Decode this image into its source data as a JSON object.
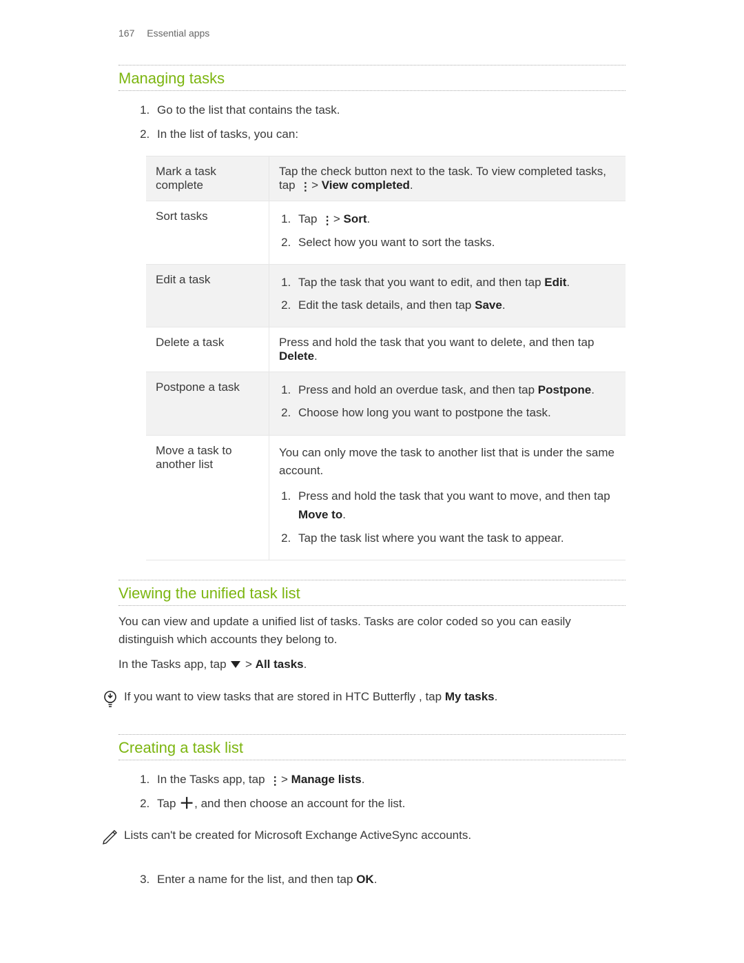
{
  "page": {
    "number": "167",
    "section": "Essential apps"
  },
  "sec1": {
    "title": "Managing tasks",
    "step1": "Go to the list that contains the task.",
    "step2": "In the list of tasks, you can:",
    "rows": {
      "mark": {
        "label": "Mark a task complete",
        "text_a": "Tap the check button next to the task. To view completed tasks, tap ",
        "text_b": " > ",
        "view_completed": "View completed",
        "period": "."
      },
      "sort": {
        "label": "Sort tasks",
        "s1a": "Tap ",
        "s1b": " > ",
        "sort_word": "Sort",
        "s1c": ".",
        "s2": "Select how you want to sort the tasks."
      },
      "edit": {
        "label": "Edit a task",
        "s1a": "Tap the task that you want to edit, and then tap ",
        "edit_word": "Edit",
        "s1b": ".",
        "s2a": "Edit the task details, and then tap ",
        "save_word": "Save",
        "s2b": "."
      },
      "delete": {
        "label": "Delete a task",
        "text_a": "Press and hold the task that you want to delete, and then tap ",
        "delete_word": "Delete",
        "text_b": "."
      },
      "postpone": {
        "label": "Postpone a task",
        "s1a": "Press and hold an overdue task, and then tap ",
        "postpone_word": "Postpone",
        "s1b": ".",
        "s2": "Choose how long you want to postpone the task."
      },
      "move": {
        "label": "Move a task to another list",
        "intro": "You can only move the task to another list that is under the same account.",
        "s1a": "Press and hold the task that you want to move, and then tap ",
        "move_word": "Move to",
        "s1b": ".",
        "s2": "Tap the task list where you want the task to appear."
      }
    }
  },
  "sec2": {
    "title": "Viewing the unified task list",
    "p1": "You can view and update a unified list of tasks. Tasks are color coded so you can easily distinguish which accounts they belong to.",
    "p2a": "In the Tasks app, tap ",
    "p2b": " > ",
    "all_tasks": "All tasks",
    "p2c": ".",
    "tip_a": "If you want to view tasks that are stored in HTC Butterfly , tap ",
    "my_tasks": "My tasks",
    "tip_b": "."
  },
  "sec3": {
    "title": "Creating a task list",
    "s1a": "In the Tasks app, tap ",
    "s1b": " > ",
    "manage_lists": "Manage lists",
    "s1c": ".",
    "s2a": "Tap ",
    "s2b": ", and then choose an account for the list.",
    "note": "Lists can't be created for Microsoft Exchange ActiveSync accounts.",
    "s3a": "Enter a name for the list, and then tap ",
    "ok_word": "OK",
    "s3b": "."
  }
}
